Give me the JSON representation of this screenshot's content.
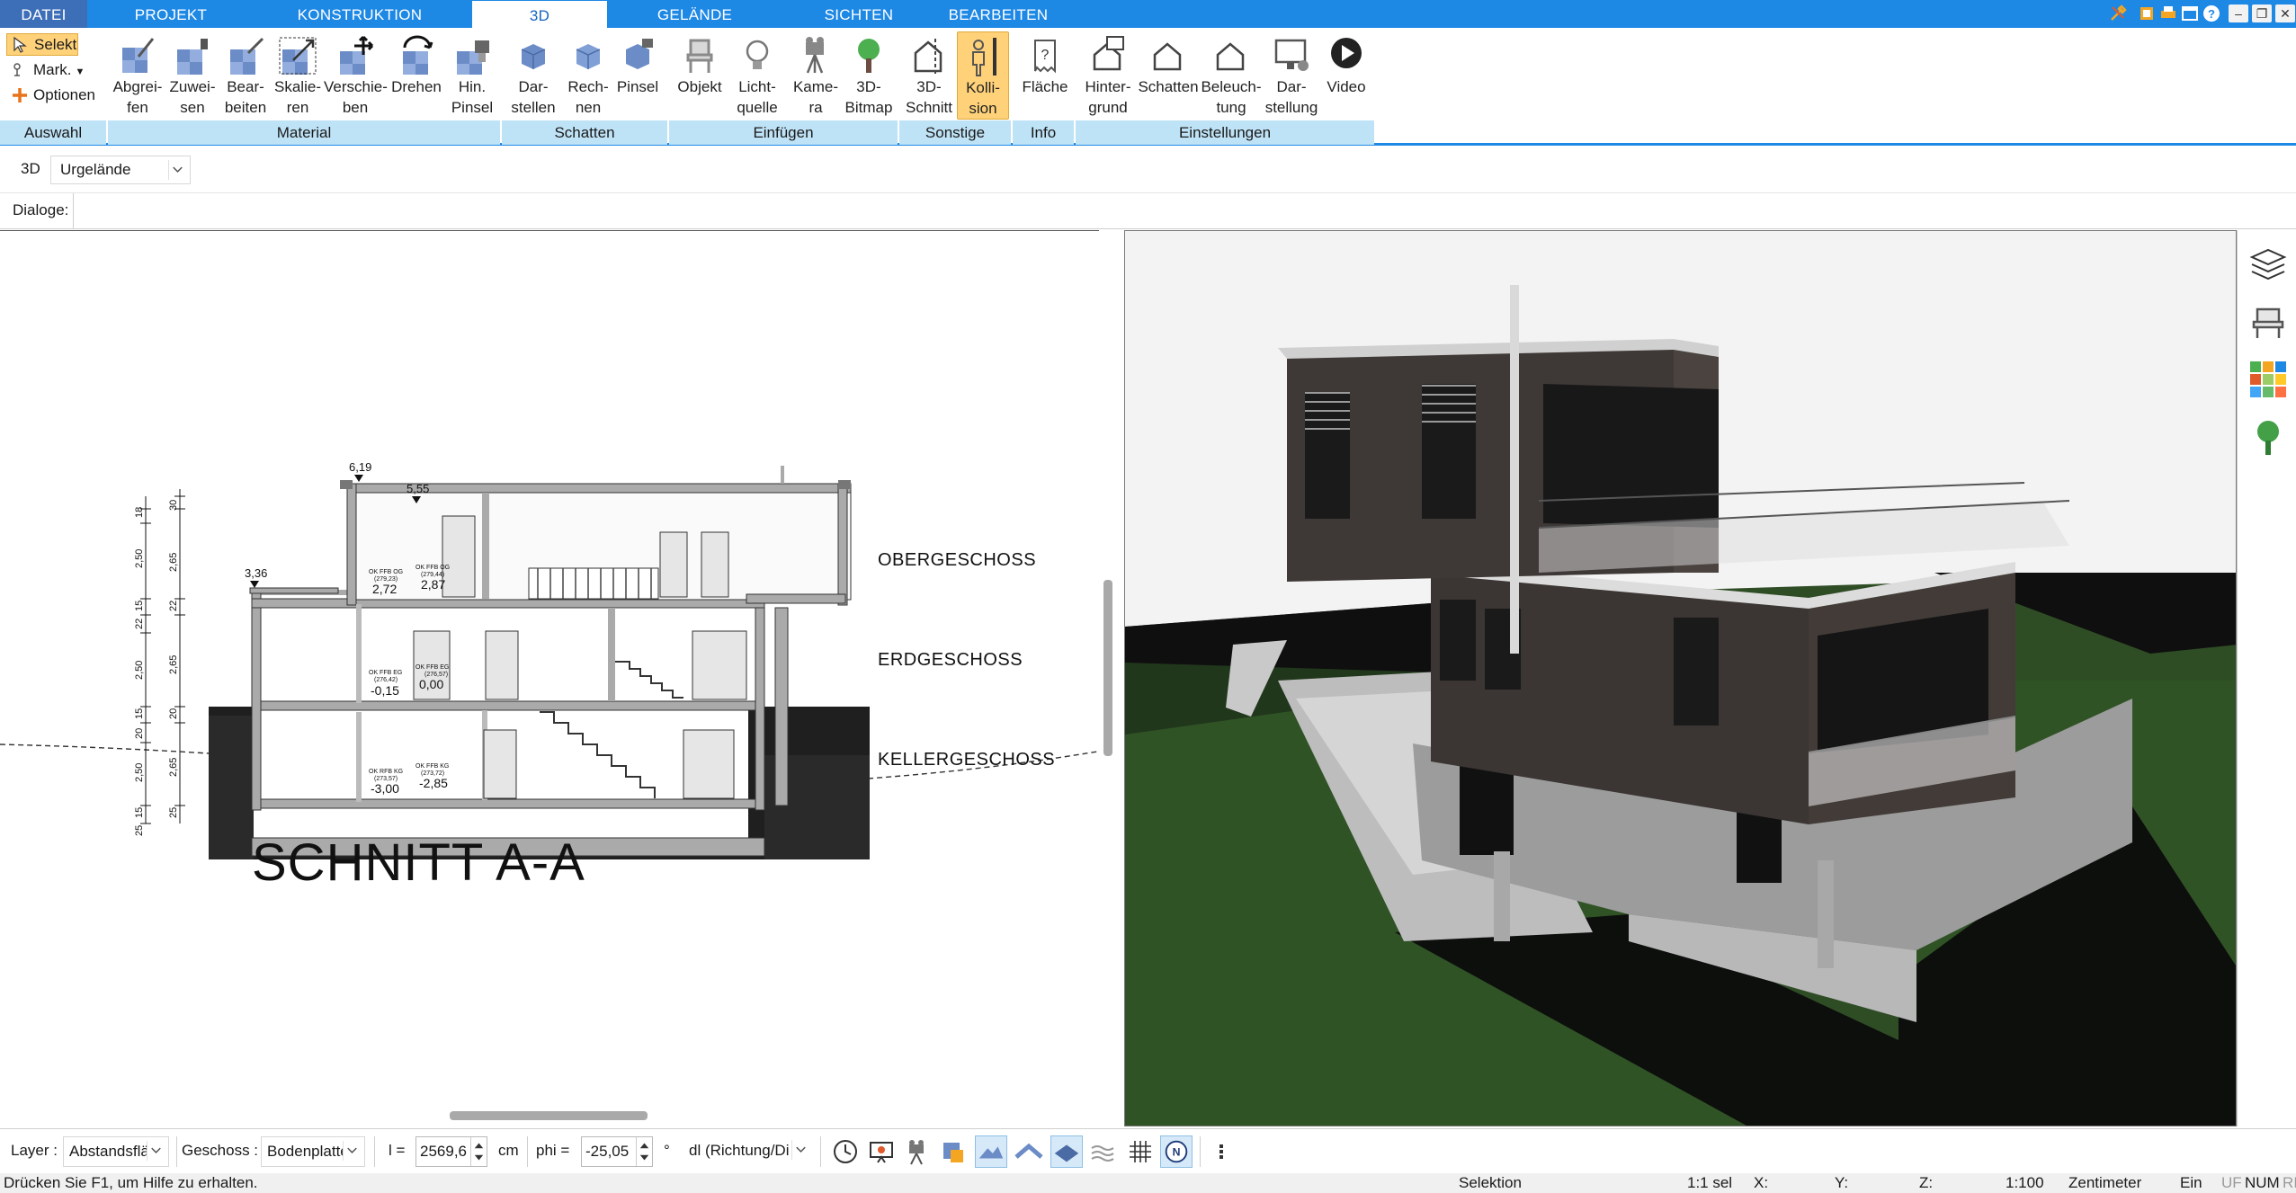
{
  "menu": {
    "tabs": [
      "DATEI",
      "PROJEKT",
      "KONSTRUKTION",
      "3D",
      "GELÄNDE",
      "SICHTEN",
      "BEARBEITEN"
    ],
    "active": "3D"
  },
  "ribbon": {
    "auswahl": {
      "selekt": "Selekt",
      "mark": "Mark.",
      "optionen": "Optionen",
      "group": "Auswahl"
    },
    "material": {
      "group": "Material",
      "buttons": [
        "Abgrei-\nfen",
        "Zuwei-\nsen",
        "Bear-\nbeiten",
        "Skalie-\nren",
        "Verschie-\nben",
        "Drehen",
        "Hin.\nPinsel"
      ]
    },
    "schatten": {
      "group": "Schatten",
      "buttons": [
        "Dar-\nstellen",
        "Rech-\nnen",
        "Pinsel"
      ]
    },
    "einfuegen": {
      "group": "Einfügen",
      "buttons": [
        "Objekt",
        "Licht-\nquelle",
        "Kame-\nra",
        "3D-\nBitmap"
      ]
    },
    "sonstige": {
      "group": "Sonstige",
      "buttons": [
        "3D-\nSchnitt",
        "Kolli-\nsion"
      ]
    },
    "info": {
      "group": "Info",
      "buttons": [
        "Fläche"
      ]
    },
    "einstellungen": {
      "group": "Einstellungen",
      "buttons": [
        "Hinter-\ngrund",
        "Schatten",
        "Beleuch-\ntung",
        "Dar-\nstellung",
        "Video"
      ]
    }
  },
  "view_row": {
    "label": "3D",
    "terrain_select": "Urgelände"
  },
  "dialog_row": {
    "label": "Dialoge:"
  },
  "section_drawing": {
    "title": "SCHNITT A-A",
    "floors": [
      "OBERGESCHOSS",
      "ERDGESCHOSS",
      "KELLERGESCHOSS"
    ],
    "heights": [
      "6,19",
      "5,55",
      "3,36"
    ],
    "levels": [
      {
        "label": "OK FFB OG",
        "sub": "(279,23)",
        "value": "2,72"
      },
      {
        "label": "OK FFB OG",
        "sub": "(279,44)",
        "value": "2,87"
      },
      {
        "label": "OK FFB EG",
        "sub": "(276,42)",
        "value": "-0,15"
      },
      {
        "label": "OK FFB EG",
        "sub": "(276,57)",
        "value": "0,00"
      },
      {
        "label": "OK RFB KG",
        "sub": "(273,57)",
        "value": "-3,00"
      },
      {
        "label": "OK FFB KG",
        "sub": "(273,72)",
        "value": "-2,85"
      }
    ],
    "dims_outer": [
      "18",
      "2,50",
      "15",
      "22",
      "2,50",
      "15",
      "20",
      "2,50",
      "15",
      "25"
    ],
    "dims_inner": [
      "30",
      "2,65",
      "22",
      "2,65",
      "20",
      "2,65",
      "25"
    ]
  },
  "bottom": {
    "layer_label": "Layer :",
    "layer_value": "Abstandsflä",
    "geschoss_label": "Geschoss :",
    "geschoss_value": "Bodenplatte",
    "l_label": "l =",
    "l_value": "2569,6",
    "l_unit": "cm",
    "phi_label": "phi =",
    "phi_value": "-25,05",
    "phi_unit": "°",
    "dl_value": "dl (Richtung/Di"
  },
  "status": {
    "help": "Drücken Sie F1, um Hilfe zu erhalten.",
    "mode": "Selektion",
    "sel": "1:1 sel",
    "x": "X:",
    "y": "Y:",
    "z": "Z:",
    "scale": "1:100",
    "unit": "Zentimeter",
    "ein": "Ein",
    "uf": "UF",
    "num": "NUM",
    "ri": "RI"
  },
  "colors": {
    "accent": "#1e88e5",
    "ribbon_group": "#bfe3f6",
    "active_button": "#ffd27a",
    "grass": "#2c4a22",
    "facade": "#3e3836"
  }
}
